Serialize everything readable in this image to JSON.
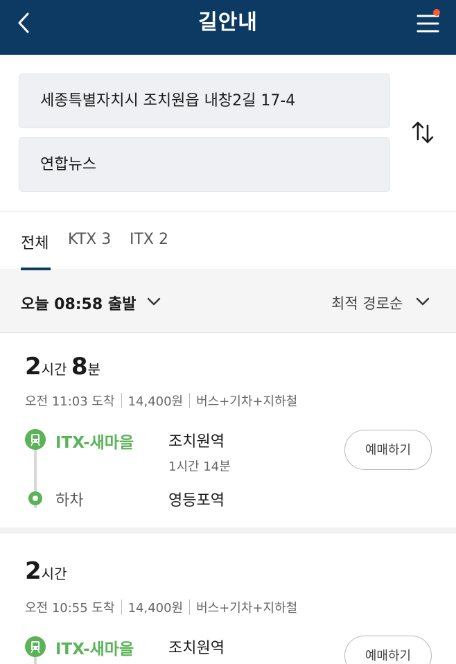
{
  "header": {
    "title": "길안내",
    "back_icon": "chevron-left-icon",
    "menu_icon": "hamburger-menu-icon",
    "notification_color": "#ff5a36",
    "bg_color": "#0c3a63"
  },
  "search": {
    "origin": "세종특별자치시 조치원읍 내창2길 17-4",
    "destination": "연합뉴스",
    "swap_icon": "swap-vertical-icon"
  },
  "tabs": [
    {
      "label": "전체",
      "active": true
    },
    {
      "label": "KTX 3",
      "active": false
    },
    {
      "label": "ITX 2",
      "active": false
    }
  ],
  "filter": {
    "departure": "오늘 08:58 출발",
    "sort": "최적 경로순"
  },
  "routes": [
    {
      "duration_hours": "2",
      "hours_unit": "시간",
      "duration_minutes": "8",
      "minutes_unit": "분",
      "arrival": "오전 11:03 도착",
      "fare": "14,400원",
      "modes": "버스+기차+지하철",
      "train": "ITX-새마을",
      "board_station": "조치원역",
      "ride_time": "1시간 14분",
      "alight_label": "하차",
      "alight_station": "영등포역",
      "book_label": "예매하기"
    },
    {
      "duration_hours": "2",
      "hours_unit": "시간",
      "arrival": "오전 10:55 도착",
      "fare": "14,400원",
      "modes": "버스+기차+지하철",
      "train": "ITX-새마을",
      "board_station": "조치원역",
      "book_label": "예매하기"
    }
  ],
  "colors": {
    "accent_green": "#5bb357",
    "tab_underline": "#0c3a63"
  }
}
